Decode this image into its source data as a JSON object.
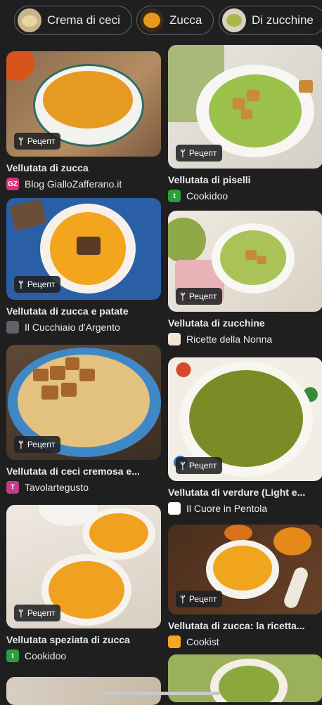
{
  "chips": [
    {
      "label": "Crema di ceci"
    },
    {
      "label": "Zucca"
    },
    {
      "label": "Di zucchine"
    }
  ],
  "badge_label": "Рецепт",
  "cards": [
    {
      "title": "Vellutata di zucca",
      "source": "Blog GialloZafferano.it",
      "favicon": "GZ"
    },
    {
      "title": "Vellutata di piselli",
      "source": "Cookidoo",
      "favicon": "t"
    },
    {
      "title": "Vellutata di zucca e patate",
      "source": "Il Cucchiaio d'Argento",
      "favicon": ""
    },
    {
      "title": "Vellutata di zucchine",
      "source": "Ricette della Nonna",
      "favicon": ""
    },
    {
      "title": "Vellutata di ceci cremosa e...",
      "source": "Tavolartegusto",
      "favicon": "T"
    },
    {
      "title": "Vellutata di verdure (Light e...",
      "source": "Il Cuore in Pentola",
      "favicon": ""
    },
    {
      "title": "Vellutata speziata di zucca",
      "source": "Cookidoo",
      "favicon": "t"
    },
    {
      "title": "Vellutata di zucca: la ricetta...",
      "source": "Cookist",
      "favicon": ""
    }
  ]
}
